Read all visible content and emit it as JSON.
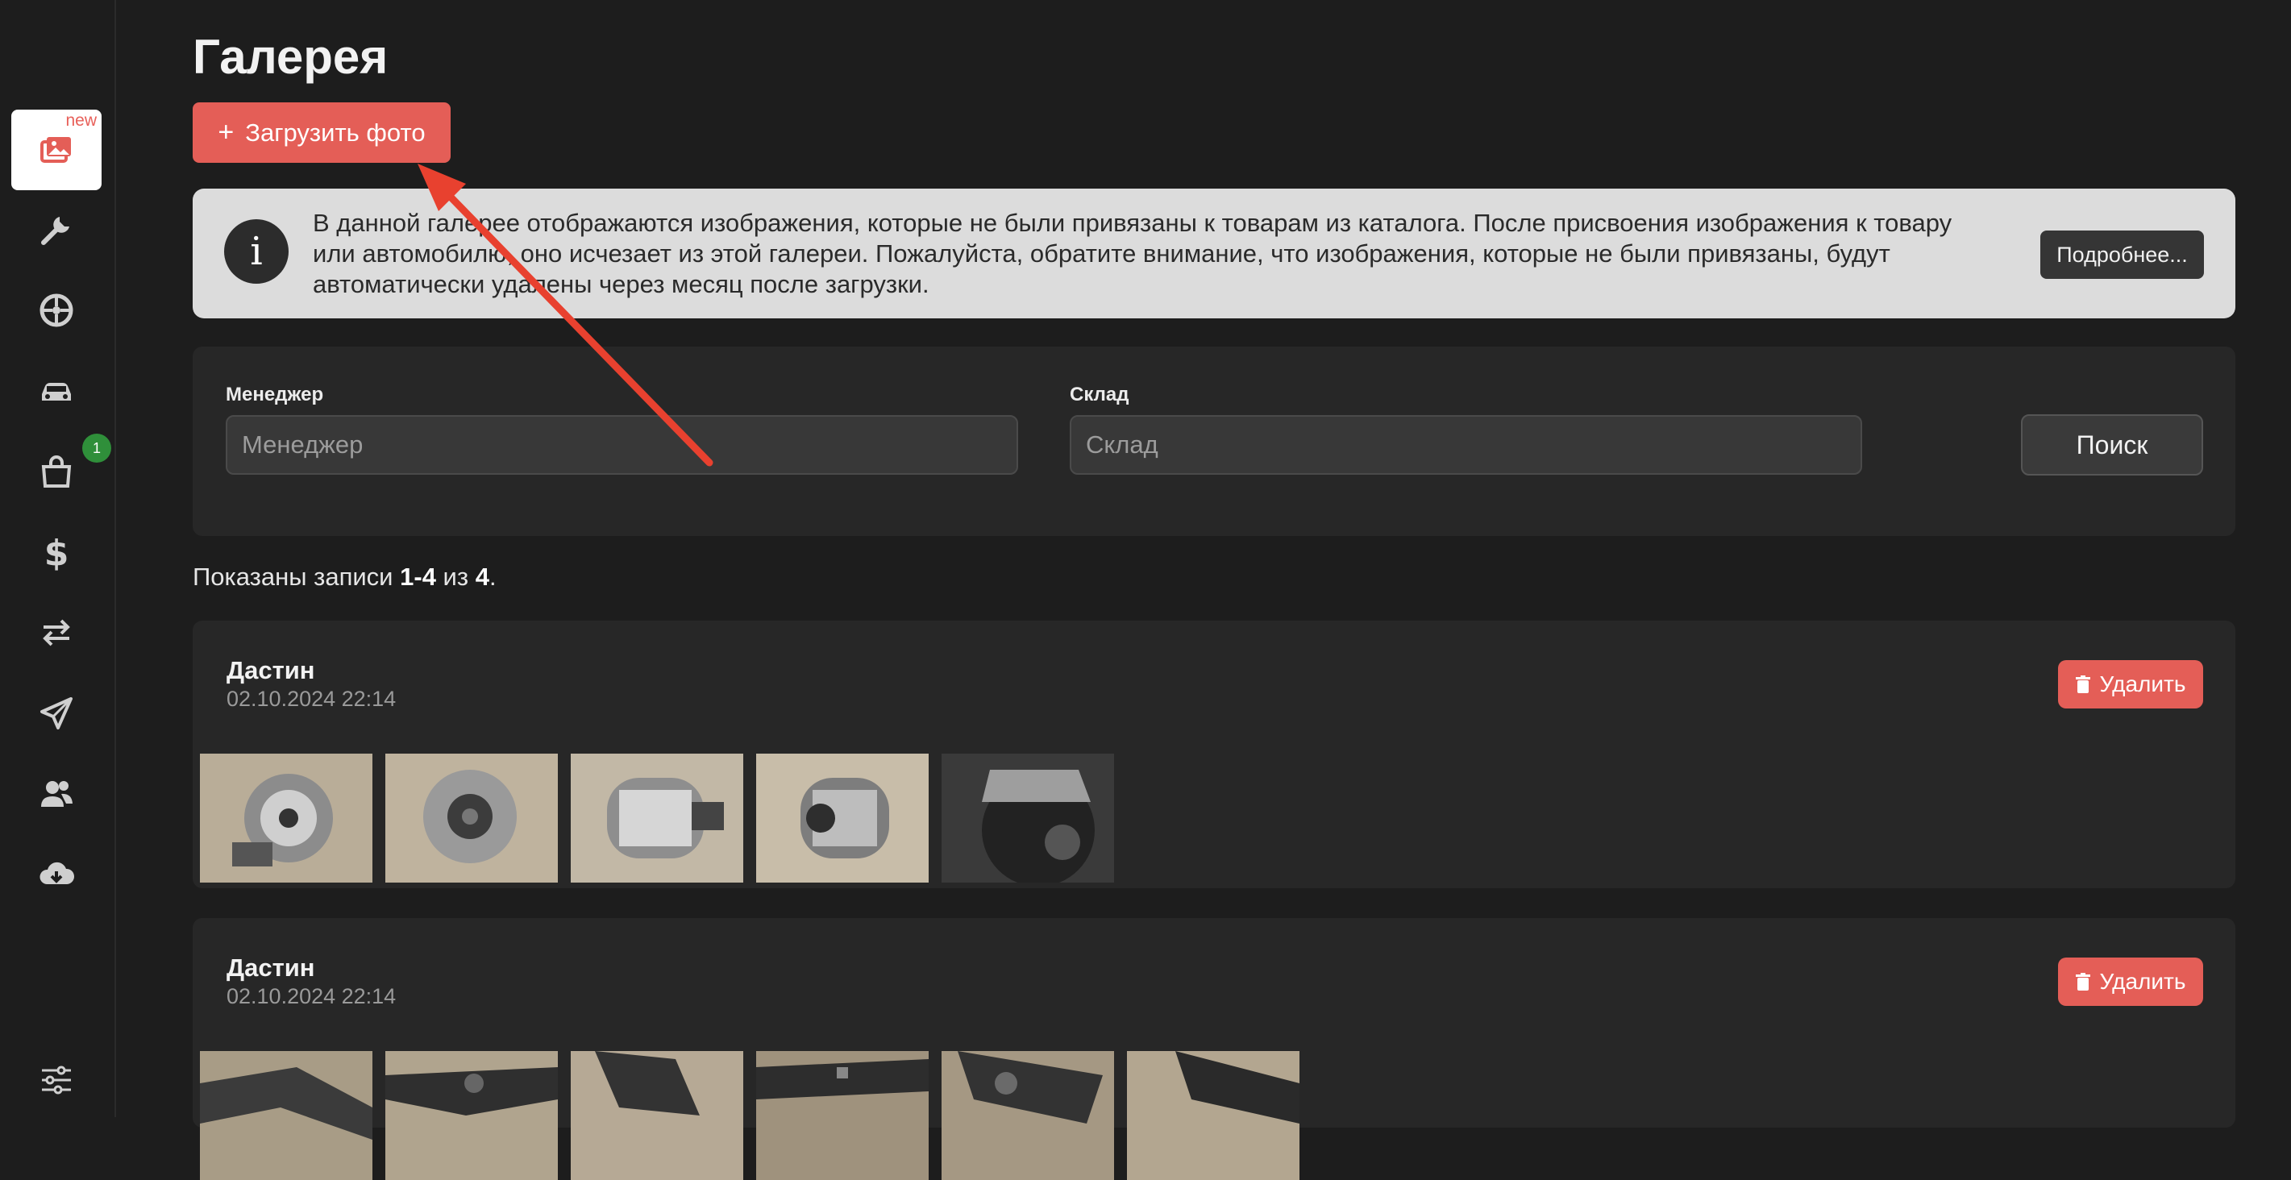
{
  "sidebar": {
    "new_tag": "new",
    "badge_count": "1",
    "icons": [
      "gallery-icon",
      "wrench-icon",
      "wheel-icon",
      "car-icon",
      "shopping-bag-icon",
      "dollar-icon",
      "transfer-icon",
      "send-icon",
      "users-icon",
      "cloud-download-icon",
      "settings-sliders-icon"
    ]
  },
  "page": {
    "title": "Галерея",
    "upload_button": "Загрузить фото",
    "upload_plus": "+"
  },
  "info": {
    "text": "В данной галерее отображаются изображения, которые не были привязаны к товарам из каталога. После присвоения изображения к товару или автомобилю, оно исчезает из этой галереи. Пожалуйста, обратите внимание, что изображения, которые не были привязаны, будут автоматически удалены через месяц после загрузки.",
    "icon_glyph": "i",
    "more_button": "Подробнее..."
  },
  "filters": {
    "manager_label": "Менеджер",
    "manager_placeholder": "Менеджер",
    "warehouse_label": "Склад",
    "warehouse_placeholder": "Склад",
    "search_button": "Поиск"
  },
  "summary": {
    "prefix": "Показаны записи ",
    "range": "1-4",
    "middle": " из ",
    "total": "4",
    "suffix": "."
  },
  "cards": [
    {
      "author": "Дастин",
      "date": "02.10.2024 22:14",
      "delete_label": "Удалить",
      "photos": [
        "alternator-photo",
        "alternator-photo",
        "alternator-photo",
        "alternator-photo",
        "alternator-closeup-photo"
      ]
    },
    {
      "author": "Дастин",
      "date": "02.10.2024 22:14",
      "delete_label": "Удалить",
      "photos": [
        "suspension-part-photo",
        "suspension-part-photo",
        "suspension-part-photo",
        "suspension-part-photo",
        "suspension-part-photo",
        "suspension-part-photo"
      ]
    }
  ],
  "colors": {
    "accent": "#e45e57",
    "background": "#1d1d1d",
    "panel": "#272727",
    "info_bg": "#dcdcdc",
    "badge": "#2f8f3a",
    "annotation_arrow": "#e8412f"
  }
}
